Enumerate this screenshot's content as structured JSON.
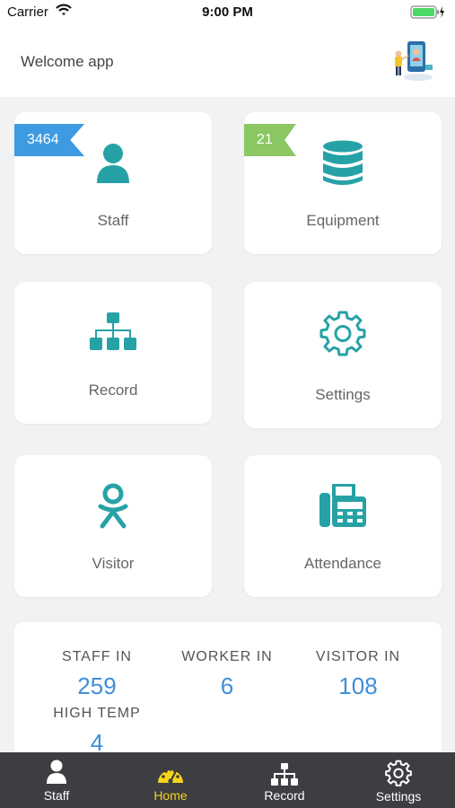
{
  "status_bar": {
    "carrier": "Carrier",
    "time": "9:00 PM"
  },
  "header": {
    "title": "Welcome app"
  },
  "colors": {
    "accent": "#26a2a6",
    "badge_blue": "#3e9be2",
    "badge_green": "#8bc763",
    "stat_value": "#3e8fd8",
    "tab_active": "#f5d21b",
    "tab_bg": "#3d3e42"
  },
  "cards": [
    {
      "label": "Staff",
      "badge": "3464",
      "icon": "user-icon"
    },
    {
      "label": "Equipment",
      "badge": "21",
      "icon": "database-icon"
    },
    {
      "label": "Record",
      "icon": "hierarchy-icon"
    },
    {
      "label": "Settings",
      "icon": "gear-icon"
    },
    {
      "label": "Visitor",
      "icon": "odnoklassniki-icon"
    },
    {
      "label": "Attendance",
      "icon": "fax-icon"
    }
  ],
  "stats": [
    {
      "label": "STAFF IN",
      "value": "259"
    },
    {
      "label": "WORKER IN",
      "value": "6"
    },
    {
      "label": "VISITOR IN",
      "value": "108"
    },
    {
      "label": "HIGH TEMP",
      "value": "4"
    }
  ],
  "tabs": [
    {
      "label": "Staff",
      "icon": "user-icon",
      "active": false
    },
    {
      "label": "Home",
      "icon": "dashboard-icon",
      "active": true
    },
    {
      "label": "Record",
      "icon": "hierarchy-icon",
      "active": false
    },
    {
      "label": "Settings",
      "icon": "gear-icon",
      "active": false
    }
  ]
}
